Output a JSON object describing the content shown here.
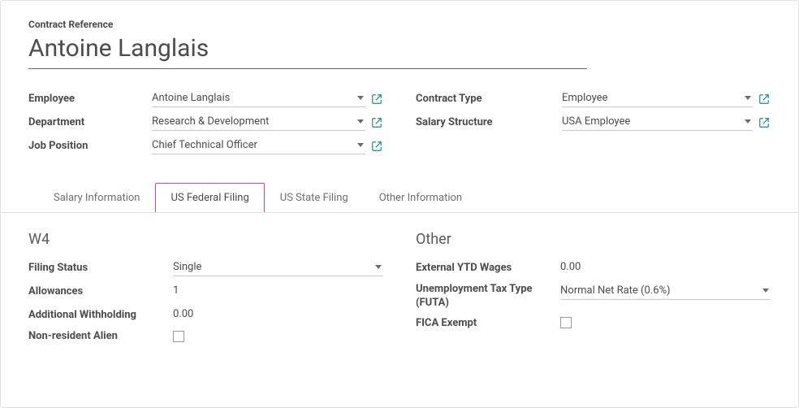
{
  "header": {
    "ref_label": "Contract Reference",
    "title": "Antoine Langlais"
  },
  "left_fields": {
    "employee_label": "Employee",
    "employee_value": "Antoine Langlais",
    "department_label": "Department",
    "department_value": "Research & Development",
    "job_label": "Job Position",
    "job_value": "Chief Technical Officer"
  },
  "right_fields": {
    "contract_type_label": "Contract Type",
    "contract_type_value": "Employee",
    "salary_struct_label": "Salary Structure",
    "salary_struct_value": "USA Employee"
  },
  "tabs": {
    "t0": "Salary Information",
    "t1": "US Federal Filing",
    "t2": "US State Filing",
    "t3": "Other Information"
  },
  "w4": {
    "title": "W4",
    "filing_status_label": "Filing Status",
    "filing_status_value": "Single",
    "allowances_label": "Allowances",
    "allowances_value": "1",
    "addl_label": "Additional Withholding",
    "addl_value": "0.00",
    "nonres_label": "Non-resident Alien"
  },
  "other": {
    "title": "Other",
    "ext_ytd_label": "External YTD Wages",
    "ext_ytd_value": "0.00",
    "unemp_label": "Unemployment Tax Type (FUTA)",
    "unemp_value": "Normal Net Rate (0.6%)",
    "fica_label": "FICA Exempt"
  }
}
